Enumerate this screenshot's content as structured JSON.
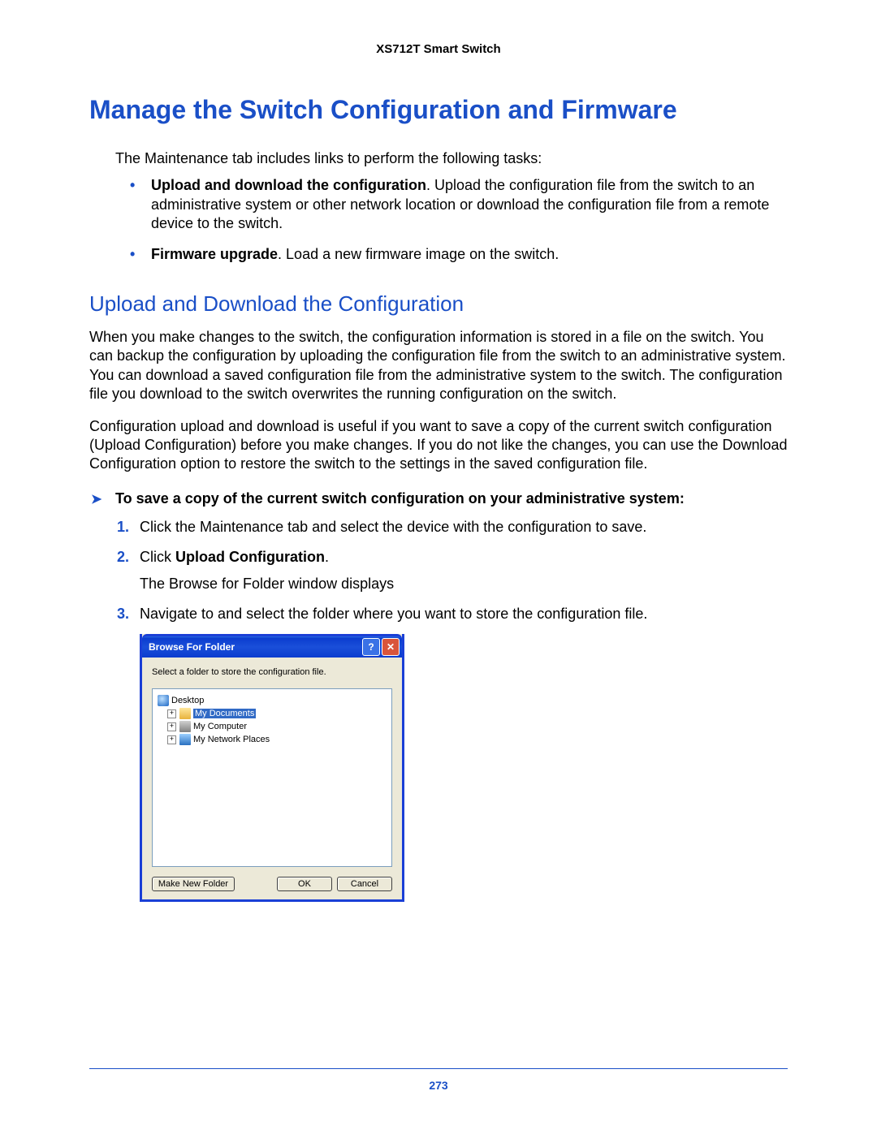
{
  "header": {
    "product": "XS712T Smart Switch"
  },
  "h1": "Manage the Switch Configuration and Firmware",
  "intro": "The Maintenance tab includes links to perform the following tasks:",
  "bullets": [
    {
      "bold": "Upload and download the configuration",
      "rest": ". Upload the configuration file from the switch to an administrative system or other network location or download the configuration file from a remote device to the switch."
    },
    {
      "bold": "Firmware upgrade",
      "rest": ". Load a new firmware image on the switch."
    }
  ],
  "h2": "Upload and Download the Configuration",
  "para1": "When you make changes to the switch, the configuration information is stored in a file on the switch. You can backup the configuration by uploading the configuration file from the switch to an administrative system. You can download a saved configuration file from the administrative system to the switch. The configuration file you download to the switch overwrites the running configuration on the switch.",
  "para2": "Configuration upload and download is useful if you want to save a copy of the current switch configuration (Upload Configuration) before you make changes. If you do not like the changes, you can use the Download Configuration option to restore the switch to the settings in the saved configuration file.",
  "procedure_title": "To save a copy of the current switch configuration on your administrative system:",
  "steps": {
    "s1": "Click the Maintenance tab and select the device with the configuration to save.",
    "s2a": "Click ",
    "s2bold": "Upload Configuration",
    "s2b": ".",
    "s2sub": "The Browse for Folder window displays",
    "s3": "Navigate to and select the folder where you want to store the configuration file."
  },
  "dialog": {
    "title": "Browse For Folder",
    "help": "?",
    "close": "✕",
    "instruction": "Select a folder to store the configuration file.",
    "tree": {
      "desktop": "Desktop",
      "mydocs": "My Documents",
      "mycomp": "My Computer",
      "mynet": "My Network Places"
    },
    "buttons": {
      "newfolder": "Make New Folder",
      "ok": "OK",
      "cancel": "Cancel"
    }
  },
  "page_number": "273"
}
